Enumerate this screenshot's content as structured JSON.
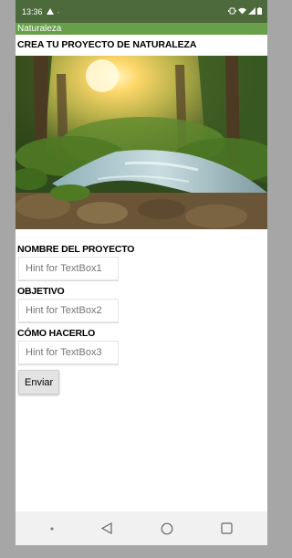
{
  "status_bar": {
    "time": "13:36",
    "alert_icon": "warning-triangle-icon",
    "dot": "·",
    "right_icons": [
      "vibrate-icon",
      "wifi-icon",
      "signal-icon",
      "battery-icon"
    ]
  },
  "app": {
    "title": "Naturaleza",
    "heading": "CREA TU PROYECTO DE NATURALEZA",
    "hero_image": "forest-stream-photo"
  },
  "form": {
    "field1": {
      "label": "NOMBRE DEL PROYECTO",
      "placeholder": "Hint for TextBox1",
      "value": ""
    },
    "field2": {
      "label": "OBJETIVO",
      "placeholder": "Hint for TextBox2",
      "value": ""
    },
    "field3": {
      "label": "CÓMO HACERLO",
      "placeholder": "Hint for TextBox3",
      "value": ""
    },
    "submit_label": "Enviar"
  },
  "nav_bar": {
    "icons": [
      "dot-icon",
      "back-triangle-icon",
      "home-circle-icon",
      "recents-square-icon"
    ]
  },
  "colors": {
    "status_bar": "#4c6a3b",
    "title_bar": "#689f49",
    "background": "#a6a6a6"
  }
}
